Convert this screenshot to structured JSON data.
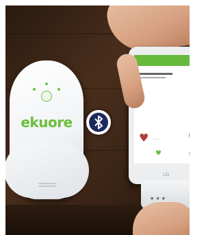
{
  "photo": {
    "device_brand": "ekuore",
    "bluetooth_icon": "bluetooth-icon",
    "phone_brand": "LG"
  }
}
